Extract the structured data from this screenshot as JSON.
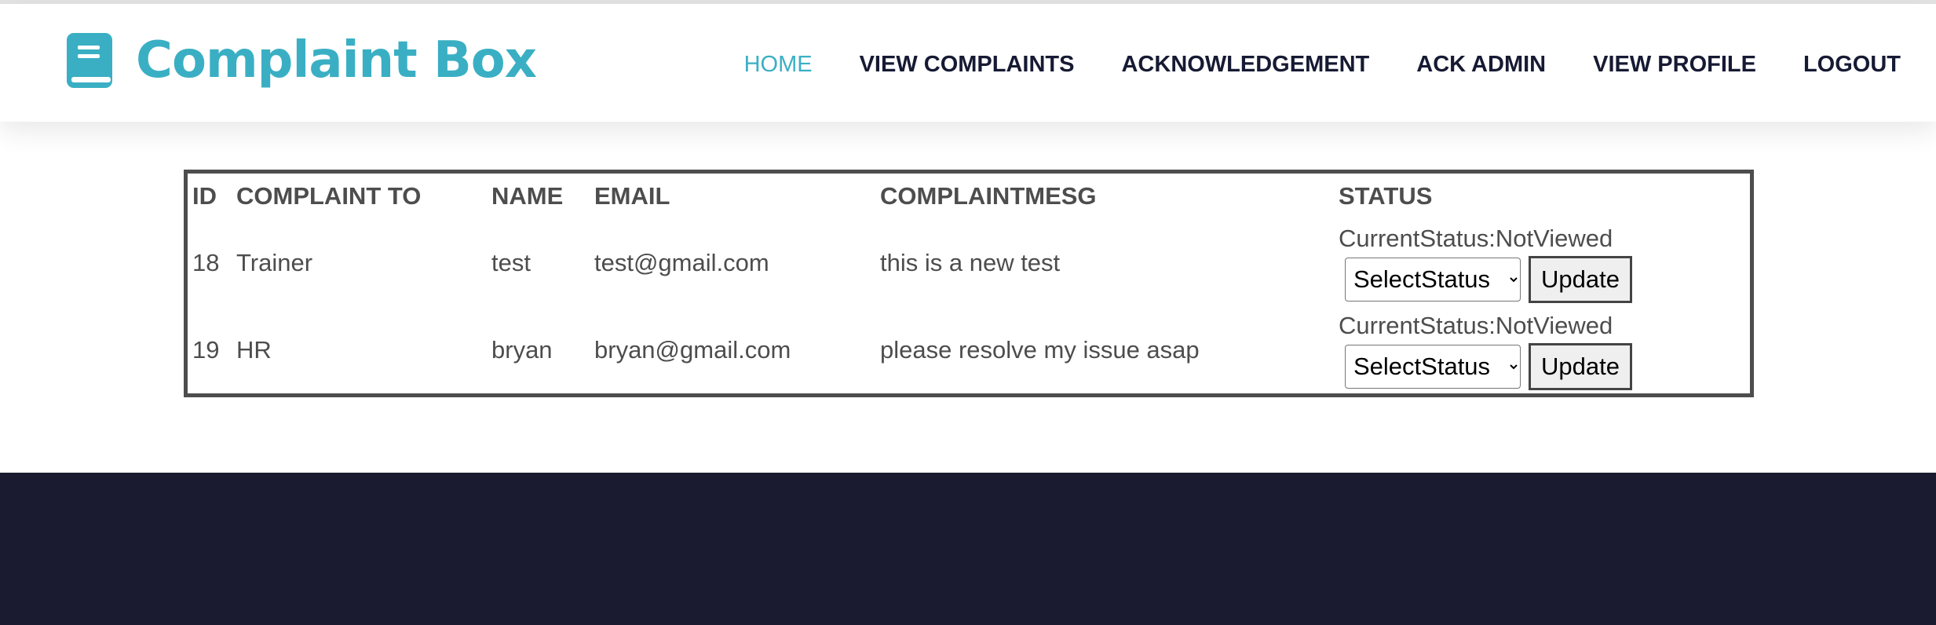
{
  "brand": {
    "name": "Complaint Box",
    "icon": "book-icon",
    "color": "#3aafc4"
  },
  "nav": {
    "items": [
      {
        "label": "HOME",
        "active": true
      },
      {
        "label": "VIEW COMPLAINTS"
      },
      {
        "label": "ACKNOWLEDGEMENT"
      },
      {
        "label": "ACK ADMIN"
      },
      {
        "label": "VIEW PROFILE"
      },
      {
        "label": "LOGOUT"
      }
    ]
  },
  "table": {
    "headers": [
      "ID",
      "COMPLAINT TO",
      "NAME",
      "EMAIL",
      "COMPLAINTMESG",
      "STATUS"
    ],
    "rows": [
      {
        "id": "18",
        "complaint_to": "Trainer",
        "name": "test",
        "email": "test@gmail.com",
        "message": "this is a new test",
        "current_status": "CurrentStatus:NotViewed",
        "select_value": "SelectStatus",
        "update_label": "Update"
      },
      {
        "id": "19",
        "complaint_to": "HR",
        "name": "bryan",
        "email": "bryan@gmail.com",
        "message": "please resolve my issue asap",
        "current_status": "CurrentStatus:NotViewed",
        "select_value": "SelectStatus",
        "update_label": "Update"
      }
    ]
  },
  "colors": {
    "accent": "#3aafc4",
    "nav_text": "#161a33",
    "table_text": "#4d4d4d",
    "footer_bg": "#1a1a30"
  }
}
